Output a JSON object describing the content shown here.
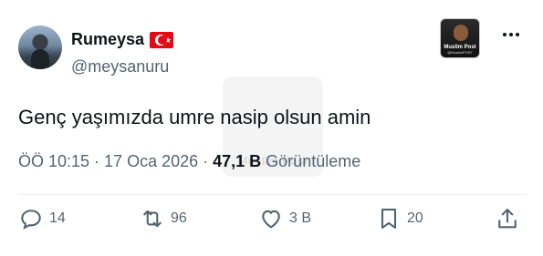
{
  "author": {
    "display_name": "Rumeysa",
    "flag": "turkey-flag",
    "handle": "@meysanuru"
  },
  "badge": {
    "title": "Muslim Post",
    "subtitle": "@MuslimPOST"
  },
  "watermark": {
    "text": "Muslim Post"
  },
  "tweet": {
    "text": "Genç yaşımızda umre nasip olsun amin"
  },
  "meta": {
    "time": "ÖÖ 10:15",
    "sep1": " · ",
    "date": "17 Oca 2026",
    "sep2": " · ",
    "views_count": "47,1 B",
    "views_label": " Görüntüleme"
  },
  "actions": {
    "replies": "14",
    "reposts": "96",
    "likes": "3 B",
    "bookmarks": "20"
  },
  "colors": {
    "text_primary": "#0f1419",
    "text_secondary": "#536471",
    "divider": "#eff3f4",
    "flag_red": "#e30a17"
  }
}
